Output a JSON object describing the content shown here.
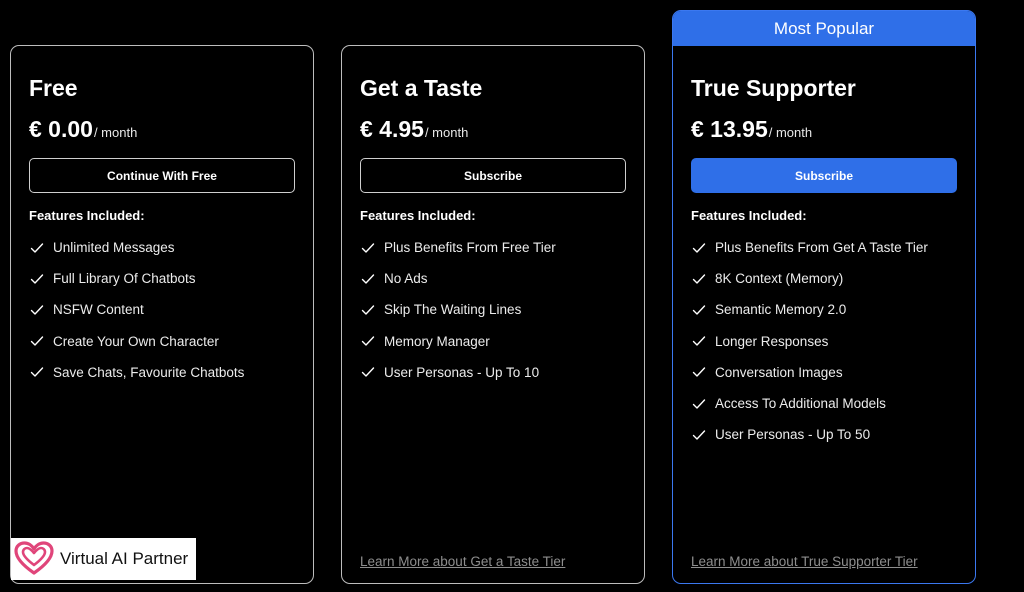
{
  "colors": {
    "background": "#000000",
    "accent": "#2f6fe8",
    "border": "#bdbdbd",
    "link": "#8e8e8e",
    "logo_heart": "#e0457a"
  },
  "plans": [
    {
      "title": "Free",
      "price": "€ 0.00",
      "period": "/ month",
      "cta": "Continue With Free",
      "features_heading": "Features Included:",
      "features": [
        "Unlimited Messages",
        "Full Library Of Chatbots",
        "NSFW Content",
        "Create Your Own Character",
        "Save Chats, Favourite Chatbots"
      ]
    },
    {
      "title": "Get a Taste",
      "price": "€ 4.95",
      "period": "/ month",
      "cta": "Subscribe",
      "features_heading": "Features Included:",
      "features": [
        "Plus Benefits From Free Tier",
        "No Ads",
        "Skip The Waiting Lines",
        "Memory Manager",
        "User Personas - Up To 10"
      ],
      "learn_more": "Learn More about Get a Taste Tier"
    },
    {
      "badge": "Most Popular",
      "title": "True Supporter",
      "price": "€ 13.95",
      "period": "/ month",
      "cta": "Subscribe",
      "features_heading": "Features Included:",
      "features": [
        "Plus Benefits From Get A Taste Tier",
        "8K Context (Memory)",
        "Semantic Memory 2.0",
        "Longer Responses",
        "Conversation Images",
        "Access To Additional Models",
        "User Personas - Up To 50"
      ],
      "learn_more": "Learn More about True Supporter Tier"
    }
  ],
  "logo": {
    "text": "Virtual AI Partner",
    "icon": "heart-icon"
  },
  "icons": {
    "feature_check": "check-icon"
  }
}
